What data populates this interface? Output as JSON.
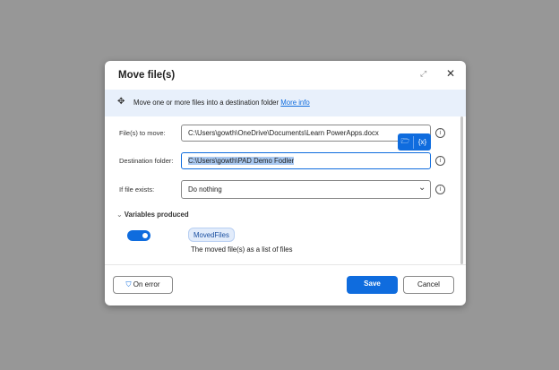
{
  "dialog": {
    "title": "Move file(s)",
    "description": "Move one or more files into a destination folder",
    "more_info": "More info"
  },
  "fields": {
    "files_label": "File(s) to move:",
    "files_value": "C:\\Users\\gowth\\OneDrive\\Documents\\Learn PowerApps.docx",
    "dest_label": "Destination folder:",
    "dest_value": "C:\\Users\\gowth\\PAD Demo Fodler",
    "exists_label": "If file exists:",
    "exists_value": "Do nothing"
  },
  "variables": {
    "header": "Variables produced",
    "enabled": true,
    "name": "MovedFiles",
    "description": "The moved file(s) as a list of files"
  },
  "footer": {
    "on_error": "On error",
    "save": "Save",
    "cancel": "Cancel"
  },
  "colors": {
    "accent": "#0f6cde",
    "band": "#e8f0fb"
  }
}
